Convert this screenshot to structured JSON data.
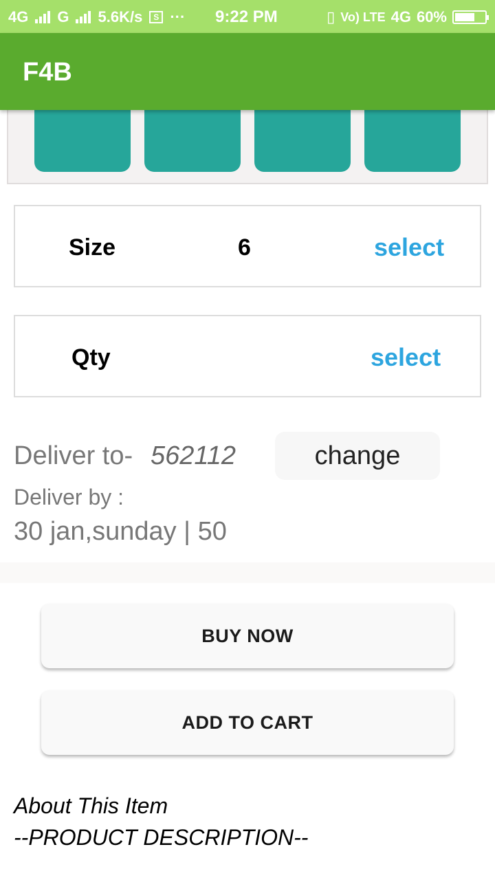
{
  "status_bar": {
    "network1": "4G",
    "network2": "G",
    "speed": "5.6K/s",
    "dots": "···",
    "time": "9:22 PM",
    "volte": "Vo) LTE",
    "network3": "4G",
    "battery": "60%"
  },
  "app_bar": {
    "title": "F4B"
  },
  "thumbnails": {
    "count": 4
  },
  "size_row": {
    "label": "Size",
    "value": "6",
    "action": "select"
  },
  "qty_row": {
    "label": "Qty",
    "value": "",
    "action": "select"
  },
  "delivery": {
    "deliver_to_label": "Deliver to-",
    "pincode": "562112",
    "change_label": "change",
    "deliver_by_label": "Deliver by :",
    "date_info": "30 jan,sunday | 50"
  },
  "actions": {
    "buy_now": "BUY NOW",
    "add_to_cart": "ADD TO CART"
  },
  "about": {
    "heading": "About This Item",
    "description": "--PRODUCT DESCRIPTION--"
  },
  "colors": {
    "status_bar": "#a5e06a",
    "app_bar": "#5aab2e",
    "thumb": "#26a69a",
    "select_link": "#2da5df"
  }
}
